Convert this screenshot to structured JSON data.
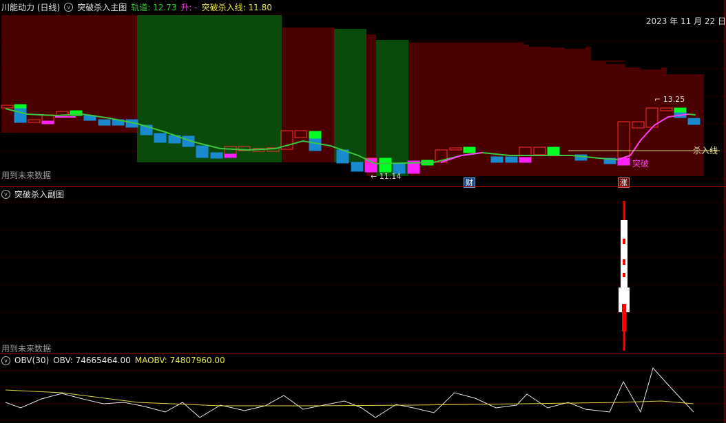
{
  "main": {
    "stock_name": "川能动力 (日线)",
    "indicator_name": "突破杀入主图",
    "track_label": "轨道:",
    "track_value": "12.73",
    "rise_label": "升: -",
    "kill_label": "突破杀入线:",
    "kill_value": "11.80",
    "date": "2023 年 11 月 22 日",
    "future_note": "用到未来数据",
    "high_annot": "13.25",
    "low_annot": "11.14",
    "kill_line_label": "杀入线",
    "breakthrough_label": "突破",
    "badge_cai": "财",
    "badge_zhang": "涨"
  },
  "sub": {
    "indicator_name": "突破杀入副图",
    "future_note": "用到未来数据"
  },
  "obv": {
    "name": "OBV(30)",
    "obv_label": "OBV:",
    "obv_value": "74665464.00",
    "maobv_label": "MAOBV:",
    "maobv_value": "74807960.00"
  },
  "colors": {
    "dark_red": "#4a0000",
    "dark_green": "#0a4a0a",
    "bright_green": "#00ff22",
    "blue_candle": "#1a8ad0",
    "magenta": "#ff22ff",
    "ma_green": "#3fc43f",
    "ma_magenta": "#ff3cf7",
    "kill_line": "#d8d878"
  }
}
